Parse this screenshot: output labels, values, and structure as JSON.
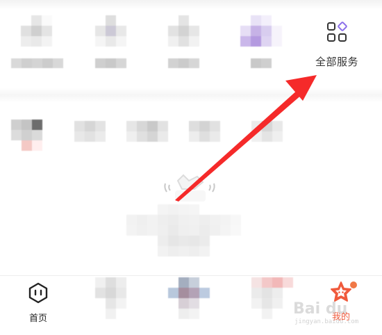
{
  "services": {
    "all_services_label": "全部服务",
    "icon": "grid-four-squares-icon"
  },
  "tabbar": {
    "home_label": "首页",
    "mine_label": "我的",
    "home_icon": "home-speech-bubble-icon",
    "mine_icon": "star-face-icon",
    "accent": "#f05a3c"
  },
  "watermark": {
    "brand": "Bai du",
    "url": "jingyan.baidu.com"
  },
  "annotation": {
    "arrow_color": "#f52a2a"
  }
}
